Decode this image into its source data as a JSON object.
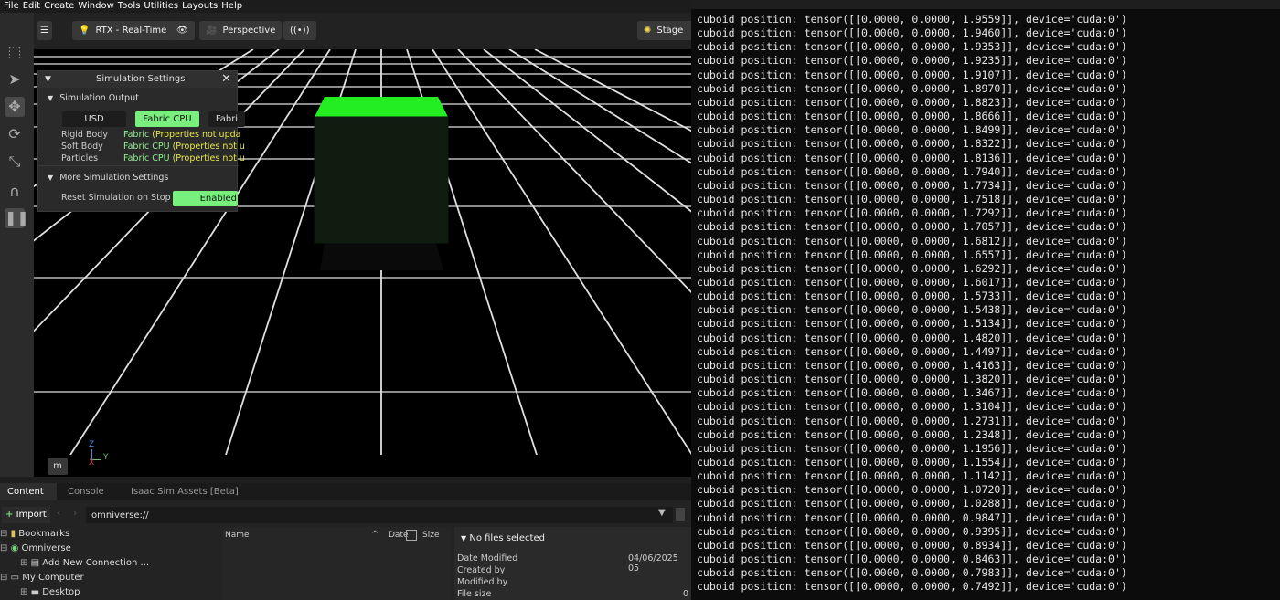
{
  "menu": [
    "File",
    "Edit",
    "Create",
    "Window",
    "Tools",
    "Utilities",
    "Layouts",
    "Help"
  ],
  "viewport": {
    "renderer_label": "RTX - Real-Time",
    "camera_label": "Perspective",
    "stage_label": "Stage",
    "axis_z": "Z",
    "axis_y": "Y",
    "axis_x": "X",
    "m_label": "m"
  },
  "sim_panel": {
    "title": "Simulation Settings",
    "section_output": "Simulation Output",
    "btn_usd": "USD",
    "btn_fabric_cpu": "Fabric CPU",
    "btn_fabric_gpu": "Fabri",
    "rows": [
      {
        "label": "Rigid Body",
        "value_prefix": "Fabric",
        "value": " (Properties not upda"
      },
      {
        "label": "Soft Body",
        "value_prefix": "Fabric CPU",
        "value": " (Properties not u"
      },
      {
        "label": "Particles",
        "value_prefix": "Fabric CPU",
        "value": " (Properties not u"
      }
    ],
    "section_more": "More Simulation Settings",
    "reset_label": "Reset Simulation on Stop",
    "reset_value": "Enabled"
  },
  "content": {
    "tabs": [
      "Content",
      "Console",
      "Isaac Sim Assets [Beta]"
    ],
    "import_label": "Import",
    "path": "omniverse://",
    "tree": [
      "Bookmarks",
      "Omniverse",
      "Add New Connection ...",
      "My Computer",
      "Desktop"
    ],
    "columns": {
      "name": "Name",
      "date": "Date",
      "size": "Size"
    },
    "details": {
      "header": "No files selected",
      "date_modified_label": "Date Modified",
      "date_modified_value": "04/06/2025 05",
      "created_by_label": "Created by",
      "modified_by_label": "Modified by",
      "file_size_label": "File size",
      "file_size_value": "0"
    }
  },
  "terminal": {
    "lines": [
      "cuboid position: tensor([[0.0000, 0.0000, 1.9559]], device='cuda:0')",
      "cuboid position: tensor([[0.0000, 0.0000, 1.9460]], device='cuda:0')",
      "cuboid position: tensor([[0.0000, 0.0000, 1.9353]], device='cuda:0')",
      "cuboid position: tensor([[0.0000, 0.0000, 1.9235]], device='cuda:0')",
      "cuboid position: tensor([[0.0000, 0.0000, 1.9107]], device='cuda:0')",
      "cuboid position: tensor([[0.0000, 0.0000, 1.8970]], device='cuda:0')",
      "cuboid position: tensor([[0.0000, 0.0000, 1.8823]], device='cuda:0')",
      "cuboid position: tensor([[0.0000, 0.0000, 1.8666]], device='cuda:0')",
      "cuboid position: tensor([[0.0000, 0.0000, 1.8499]], device='cuda:0')",
      "cuboid position: tensor([[0.0000, 0.0000, 1.8322]], device='cuda:0')",
      "cuboid position: tensor([[0.0000, 0.0000, 1.8136]], device='cuda:0')",
      "cuboid position: tensor([[0.0000, 0.0000, 1.7940]], device='cuda:0')",
      "cuboid position: tensor([[0.0000, 0.0000, 1.7734]], device='cuda:0')",
      "cuboid position: tensor([[0.0000, 0.0000, 1.7518]], device='cuda:0')",
      "cuboid position: tensor([[0.0000, 0.0000, 1.7292]], device='cuda:0')",
      "cuboid position: tensor([[0.0000, 0.0000, 1.7057]], device='cuda:0')",
      "cuboid position: tensor([[0.0000, 0.0000, 1.6812]], device='cuda:0')",
      "cuboid position: tensor([[0.0000, 0.0000, 1.6557]], device='cuda:0')",
      "cuboid position: tensor([[0.0000, 0.0000, 1.6292]], device='cuda:0')",
      "cuboid position: tensor([[0.0000, 0.0000, 1.6017]], device='cuda:0')",
      "cuboid position: tensor([[0.0000, 0.0000, 1.5733]], device='cuda:0')",
      "cuboid position: tensor([[0.0000, 0.0000, 1.5438]], device='cuda:0')",
      "cuboid position: tensor([[0.0000, 0.0000, 1.5134]], device='cuda:0')",
      "cuboid position: tensor([[0.0000, 0.0000, 1.4820]], device='cuda:0')",
      "cuboid position: tensor([[0.0000, 0.0000, 1.4497]], device='cuda:0')",
      "cuboid position: tensor([[0.0000, 0.0000, 1.4163]], device='cuda:0')",
      "cuboid position: tensor([[0.0000, 0.0000, 1.3820]], device='cuda:0')",
      "cuboid position: tensor([[0.0000, 0.0000, 1.3467]], device='cuda:0')",
      "cuboid position: tensor([[0.0000, 0.0000, 1.3104]], device='cuda:0')",
      "cuboid position: tensor([[0.0000, 0.0000, 1.2731]], device='cuda:0')",
      "cuboid position: tensor([[0.0000, 0.0000, 1.2348]], device='cuda:0')",
      "cuboid position: tensor([[0.0000, 0.0000, 1.1956]], device='cuda:0')",
      "cuboid position: tensor([[0.0000, 0.0000, 1.1554]], device='cuda:0')",
      "cuboid position: tensor([[0.0000, 0.0000, 1.1142]], device='cuda:0')",
      "cuboid position: tensor([[0.0000, 0.0000, 1.0720]], device='cuda:0')",
      "cuboid position: tensor([[0.0000, 0.0000, 1.0288]], device='cuda:0')",
      "cuboid position: tensor([[0.0000, 0.0000, 0.9847]], device='cuda:0')",
      "cuboid position: tensor([[0.0000, 0.0000, 0.9395]], device='cuda:0')",
      "cuboid position: tensor([[0.0000, 0.0000, 0.8934]], device='cuda:0')",
      "cuboid position: tensor([[0.0000, 0.0000, 0.8463]], device='cuda:0')",
      "cuboid position: tensor([[0.0000, 0.0000, 0.7983]], device='cuda:0')",
      "cuboid position: tensor([[0.0000, 0.0000, 0.7492]], device='cuda:0')"
    ]
  },
  "colors": {
    "cube_top": "#22ee22",
    "accent_green": "#79f07d",
    "warning_yellow": "#e8e84a"
  }
}
